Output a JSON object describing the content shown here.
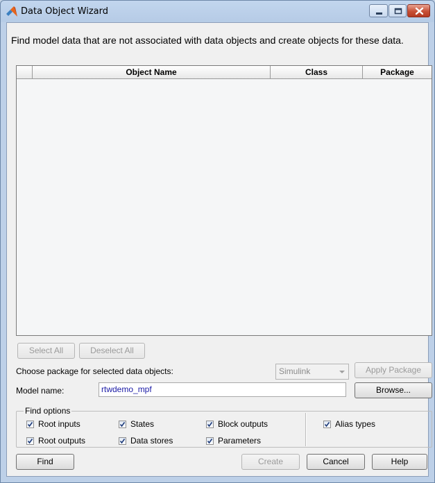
{
  "window": {
    "title": "Data Object Wizard"
  },
  "instructions": "Find model data that are not associated with data objects and create objects for these data.",
  "table": {
    "columns": [
      "",
      "Object Name",
      "Class",
      "Package"
    ],
    "rows": []
  },
  "selection_buttons": {
    "select_all": "Select All",
    "deselect_all": "Deselect All"
  },
  "package_row": {
    "label": "Choose package for selected data objects:",
    "selected_package": "Simulink",
    "apply_label": "Apply Package"
  },
  "model_row": {
    "label": "Model name:",
    "value": "rtwdemo_mpf",
    "browse_label": "Browse..."
  },
  "find_options": {
    "title": "Find options",
    "checkboxes": [
      {
        "label": "Root inputs",
        "checked": true
      },
      {
        "label": "States",
        "checked": true
      },
      {
        "label": "Block outputs",
        "checked": true
      },
      {
        "label": "Alias types",
        "checked": true
      },
      {
        "label": "Root outputs",
        "checked": true
      },
      {
        "label": "Data stores",
        "checked": true
      },
      {
        "label": "Parameters",
        "checked": true
      }
    ]
  },
  "footer": {
    "find": "Find",
    "create": "Create",
    "cancel": "Cancel",
    "help": "Help"
  }
}
